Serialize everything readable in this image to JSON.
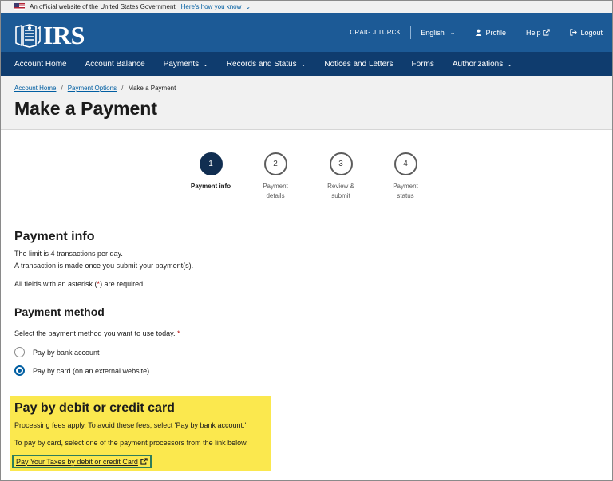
{
  "gov_banner": {
    "text": "An official website of the United States Government",
    "link": "Here's how you know"
  },
  "header": {
    "logo_text": "IRS",
    "user_name": "CRAIG J TURCK",
    "language": "English",
    "profile": "Profile",
    "help": "Help",
    "logout": "Logout"
  },
  "nav": {
    "items": [
      {
        "label": "Account Home",
        "has_caret": false
      },
      {
        "label": "Account Balance",
        "has_caret": false
      },
      {
        "label": "Payments",
        "has_caret": true
      },
      {
        "label": "Records and Status",
        "has_caret": true
      },
      {
        "label": "Notices and Letters",
        "has_caret": false
      },
      {
        "label": "Forms",
        "has_caret": false
      },
      {
        "label": "Authorizations",
        "has_caret": true
      }
    ]
  },
  "breadcrumb": {
    "items": [
      "Account Home",
      "Payment Options",
      "Make a Payment"
    ]
  },
  "page_title": "Make a Payment",
  "stepper": {
    "steps": [
      {
        "number": "1",
        "label_line1": "Payment info",
        "label_line2": "",
        "active": true
      },
      {
        "number": "2",
        "label_line1": "Payment",
        "label_line2": "details",
        "active": false
      },
      {
        "number": "3",
        "label_line1": "Review &",
        "label_line2": "submit",
        "active": false
      },
      {
        "number": "4",
        "label_line1": "Payment",
        "label_line2": "status",
        "active": false
      }
    ]
  },
  "payment_info": {
    "heading": "Payment info",
    "limit_text": "The limit is 4 transactions per day.",
    "transaction_text": "A transaction is made once you submit your payment(s).",
    "required_prefix": "All fields with an asterisk (",
    "required_mark": "*",
    "required_suffix": ") are required."
  },
  "payment_method": {
    "heading": "Payment method",
    "prompt": "Select the payment method you want to use today.",
    "required_mark": "*",
    "options": [
      {
        "label": "Pay by bank account",
        "selected": false
      },
      {
        "label": "Pay by card (on an external website)",
        "selected": true
      }
    ]
  },
  "card_section": {
    "heading": "Pay by debit or credit card",
    "fees_text": "Processing fees apply. To avoid these fees, select 'Pay by bank account.'",
    "instructions": "To pay by card, select one of the payment processors from the link below.",
    "link_text": "Pay Your Taxes by debit or credit Card"
  },
  "colors": {
    "header_blue": "#1c5a96",
    "nav_blue": "#0f3c6e",
    "active_step": "#112e51",
    "highlight_yellow": "#fbe84e",
    "link_blue": "#005ea2",
    "required_red": "#b50909"
  }
}
